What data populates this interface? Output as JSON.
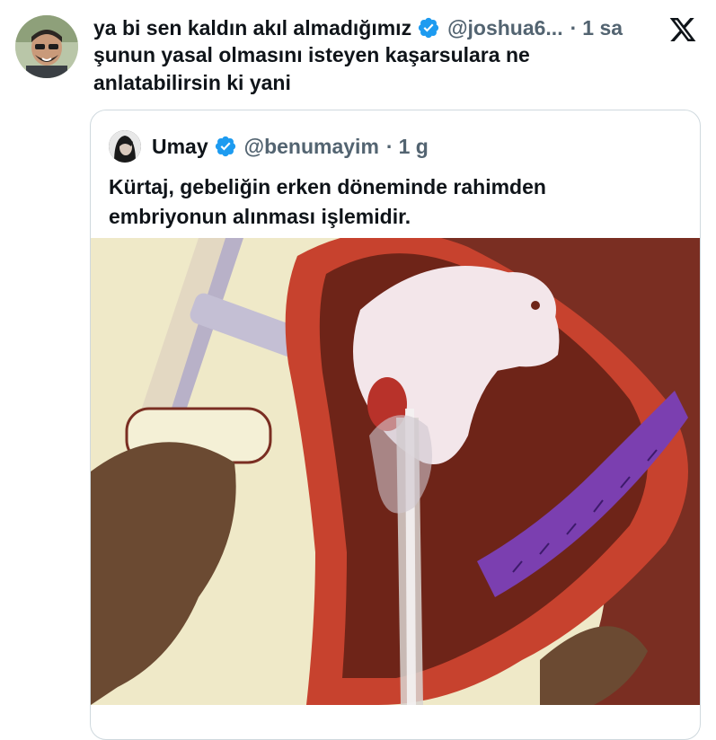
{
  "tweet": {
    "author_name": "ya bi sen kaldın akıl almadığımız",
    "handle": "@joshua6...",
    "separator": "·",
    "time": "1 sa",
    "text": "şunun yasal olmasını isteyen kaşarsulara ne anlatabilirsin ki yani"
  },
  "quoted": {
    "author_name": "Umay",
    "handle": "@benumayim",
    "separator": "·",
    "time": "1 g",
    "text": "Kürtaj, gebeliğin erken döneminde rahimden embriyonun alınması işlemidir."
  },
  "icons": {
    "verified": "verified-badge-icon",
    "platform": "x-logo-icon"
  },
  "colors": {
    "verified_blue": "#1d9bf0",
    "text_primary": "#0f1419",
    "text_secondary": "#536471",
    "border": "#cfd9de"
  }
}
